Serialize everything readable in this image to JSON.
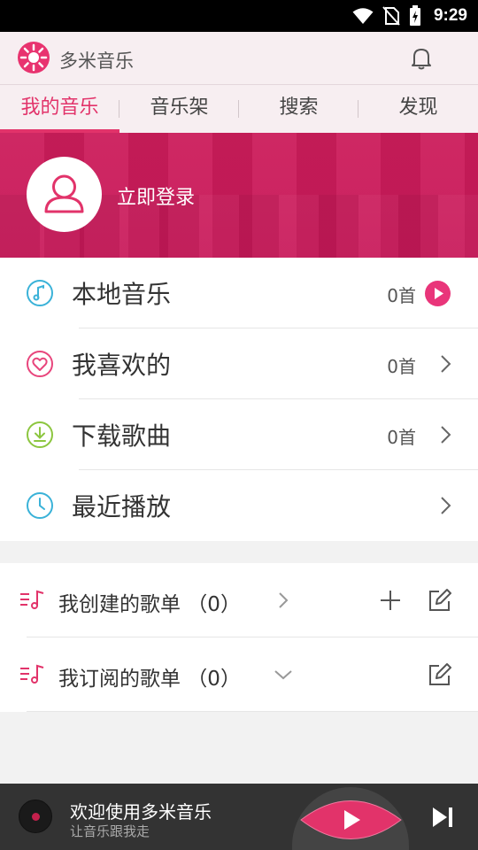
{
  "status_bar": {
    "time": "9:29"
  },
  "app_bar": {
    "title": "多米音乐"
  },
  "tabs": [
    {
      "label": "我的音乐",
      "active": true
    },
    {
      "label": "音乐架",
      "active": false
    },
    {
      "label": "搜索",
      "active": false
    },
    {
      "label": "发现",
      "active": false
    }
  ],
  "banner": {
    "login_label": "立即登录"
  },
  "menu": {
    "local": {
      "label": "本地音乐",
      "count": "0首"
    },
    "favorites": {
      "label": "我喜欢的",
      "count": "0首"
    },
    "downloads": {
      "label": "下载歌曲",
      "count": "0首"
    },
    "recent": {
      "label": "最近播放"
    }
  },
  "playlists": {
    "created": {
      "label": "我创建的歌单 （0）"
    },
    "subscribed": {
      "label": "我订阅的歌单 （0）"
    }
  },
  "player": {
    "title": "欢迎使用多米音乐",
    "subtitle": "让音乐跟我走"
  },
  "colors": {
    "accent": "#e2336a",
    "banner": "#c91b59",
    "player_bg": "#333333"
  }
}
